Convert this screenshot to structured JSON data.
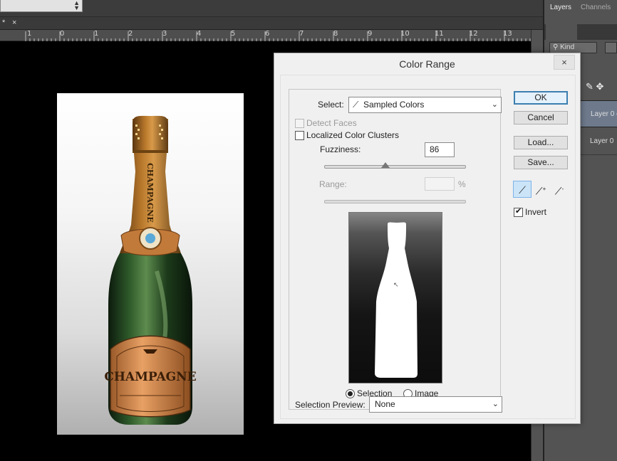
{
  "tabs": {
    "star": "*",
    "close": "×"
  },
  "ruler": {
    "labels": [
      "1",
      "0",
      "1",
      "2",
      "3",
      "4",
      "5",
      "6",
      "7",
      "8",
      "9",
      "10",
      "11",
      "12",
      "13"
    ]
  },
  "layers_panel": {
    "tabs": [
      "Layers",
      "Channels"
    ],
    "kind_filter": "Kind",
    "layers": [
      "Layer 0 c",
      "Layer 0"
    ]
  },
  "document": {
    "neck_text": "CHAMPAGNE",
    "label_text": "CHAMPAGNE"
  },
  "dialog": {
    "title": "Color Range",
    "close_glyph": "×",
    "select_label": "Select:",
    "select_value": "Sampled Colors",
    "detect_faces": {
      "label": "Detect Faces",
      "checked": false,
      "enabled": false
    },
    "localized_clusters": {
      "label": "Localized Color Clusters",
      "checked": false
    },
    "fuzziness_label": "Fuzziness:",
    "fuzziness_value": "86",
    "range_label": "Range:",
    "range_unit": "%",
    "preview_modes": {
      "selection": "Selection",
      "image": "Image",
      "selected": "selection"
    },
    "selection_preview_label": "Selection Preview:",
    "selection_preview_value": "None",
    "buttons": {
      "ok": "OK",
      "cancel": "Cancel",
      "load": "Load...",
      "save": "Save..."
    },
    "eyedroppers": {
      "plus": "+",
      "minus": "-"
    },
    "invert": {
      "label": "Invert",
      "checked": true
    }
  }
}
